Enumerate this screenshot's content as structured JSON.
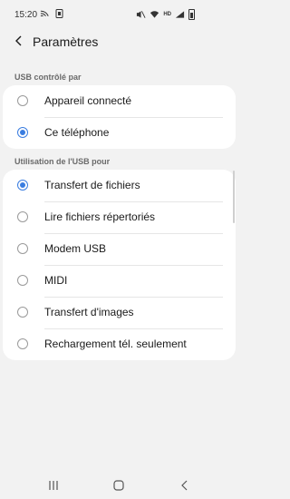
{
  "status_bar": {
    "time": "15:20",
    "icons_left": [
      "cast-icon",
      "sim-card-icon"
    ],
    "icons_right": [
      "mute-icon",
      "wifi-icon",
      "hd-icon",
      "signal-icon",
      "battery-icon"
    ],
    "hd_text": "HD"
  },
  "header": {
    "title": "Paramètres",
    "back_icon": "chevron-left-icon"
  },
  "usb_controlled_by": {
    "label": "USB contrôlé par",
    "options": [
      {
        "label": "Appareil connecté",
        "checked": false
      },
      {
        "label": "Ce téléphone",
        "checked": true
      }
    ]
  },
  "usb_usage": {
    "label": "Utilisation de l'USB pour",
    "options": [
      {
        "label": "Transfert de fichiers",
        "checked": true
      },
      {
        "label": "Lire fichiers répertoriés",
        "checked": false
      },
      {
        "label": "Modem USB",
        "checked": false
      },
      {
        "label": "MIDI",
        "checked": false
      },
      {
        "label": "Transfert d'images",
        "checked": false
      },
      {
        "label": "Rechargement tél. seulement",
        "checked": false
      }
    ]
  },
  "nav_bar": {
    "buttons": [
      "recents-icon",
      "home-icon",
      "back-icon"
    ]
  },
  "colors": {
    "accent": "#3a7de0",
    "background": "#f2f2f2",
    "card": "#ffffff"
  }
}
